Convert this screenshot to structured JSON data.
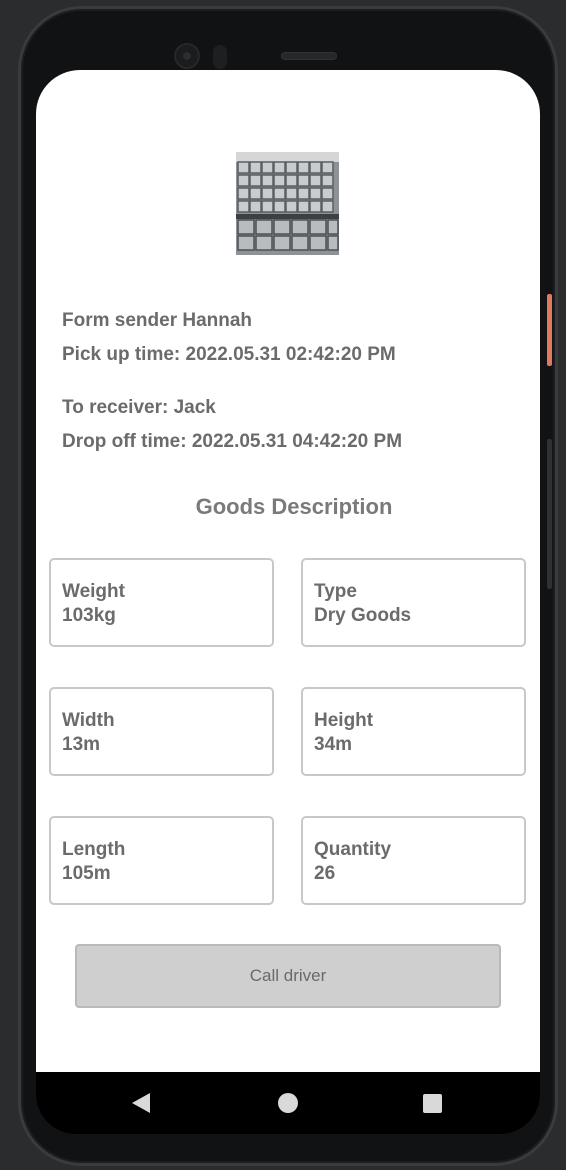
{
  "sender": {
    "label": "Form sender Hannah",
    "pickup": "Pick up time: 2022.05.31 02:42:20 PM"
  },
  "receiver": {
    "label": "To receiver: Jack",
    "dropoff": "Drop off time: 2022.05.31 04:42:20 PM"
  },
  "goods_title": "Goods Description",
  "goods": {
    "weight": {
      "label": "Weight",
      "value": "103kg"
    },
    "type": {
      "label": "Type",
      "value": "Dry Goods"
    },
    "width": {
      "label": "Width",
      "value": "13m"
    },
    "height": {
      "label": "Height",
      "value": "34m"
    },
    "length": {
      "label": "Length",
      "value": "105m"
    },
    "quantity": {
      "label": "Quantity",
      "value": "26"
    }
  },
  "call_button": "Call driver",
  "nav": {
    "back_icon": "triangle-back-icon",
    "home_icon": "circle-home-icon",
    "recent_icon": "square-recents-icon"
  },
  "colors": {
    "text": "#6b6b6b",
    "button_bg": "#cfcfcf",
    "card_border": "#c8c8c8"
  }
}
